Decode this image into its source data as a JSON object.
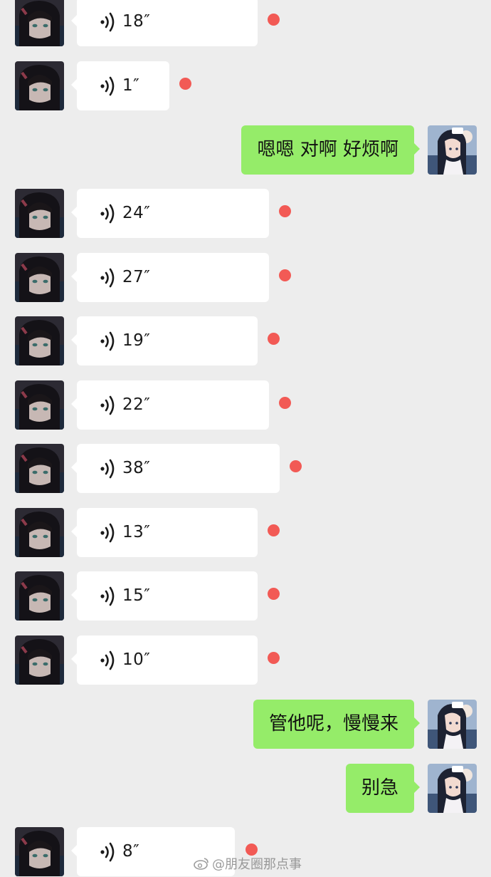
{
  "messages": [
    {
      "side": "left",
      "type": "voice",
      "duration": "18″",
      "unread": true
    },
    {
      "side": "left",
      "type": "voice",
      "duration": "1″",
      "unread": true
    },
    {
      "side": "right",
      "type": "text",
      "text": "嗯嗯 对啊 好烦啊"
    },
    {
      "side": "left",
      "type": "voice",
      "duration": "24″",
      "unread": true
    },
    {
      "side": "left",
      "type": "voice",
      "duration": "27″",
      "unread": true
    },
    {
      "side": "left",
      "type": "voice",
      "duration": "19″",
      "unread": true
    },
    {
      "side": "left",
      "type": "voice",
      "duration": "22″",
      "unread": true
    },
    {
      "side": "left",
      "type": "voice",
      "duration": "38″",
      "unread": true
    },
    {
      "side": "left",
      "type": "voice",
      "duration": "13″",
      "unread": true
    },
    {
      "side": "left",
      "type": "voice",
      "duration": "15″",
      "unread": true
    },
    {
      "side": "left",
      "type": "voice",
      "duration": "10″",
      "unread": true
    },
    {
      "side": "right",
      "type": "text",
      "text": "管他呢，慢慢来"
    },
    {
      "side": "right",
      "type": "text",
      "text": "别急"
    },
    {
      "side": "left",
      "type": "voice",
      "duration": "8″",
      "unread": true
    }
  ],
  "watermark": {
    "text": "@朋友圈那点事",
    "icon": "weibo-icon"
  },
  "colors": {
    "background": "#ededed",
    "incoming_bubble": "#ffffff",
    "outgoing_bubble": "#95ec69",
    "unread_dot": "#f25a55"
  },
  "icons": {
    "voice": "voice-wave-icon",
    "incoming_avatar": "avatar-dark-hair-character",
    "outgoing_avatar": "avatar-nurse-character"
  }
}
